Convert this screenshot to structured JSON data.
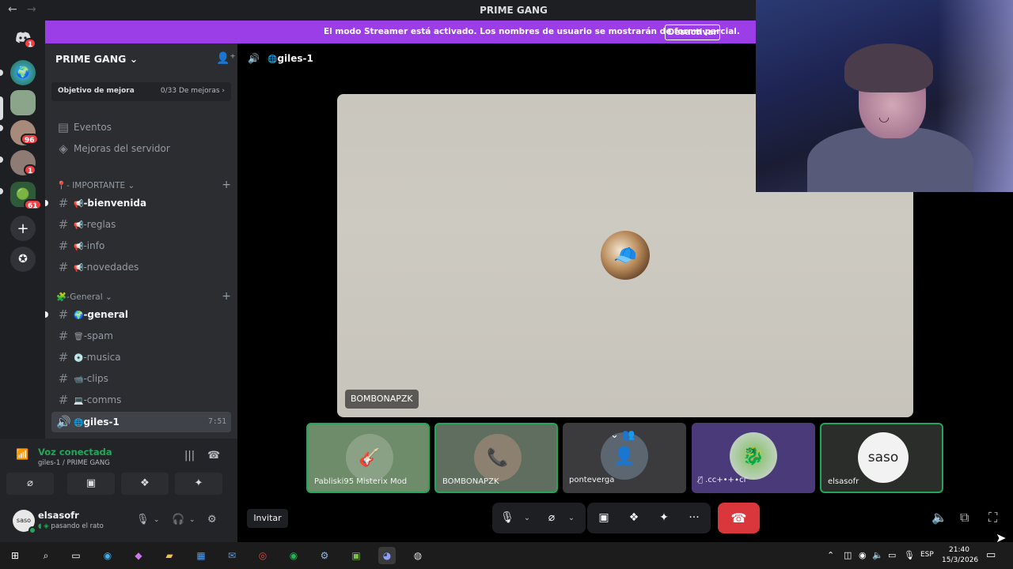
{
  "window": {
    "title": "PRIME GANG"
  },
  "banner": {
    "text": "El modo Streamer está activado. Los nombres de usuario se mostrarán de forma parcial.",
    "button": "Desactivar"
  },
  "servers": [
    {
      "icon": "discord-home-icon",
      "badge": "1"
    },
    {
      "icon": "globe-server-icon",
      "badge": ""
    },
    {
      "icon": "server-avatar-icon",
      "badge": ""
    },
    {
      "icon": "server-avatar-icon",
      "badge": "96"
    },
    {
      "icon": "server-avatar-icon",
      "badge": "1"
    },
    {
      "icon": "server-folder-icon",
      "badge": "61"
    }
  ],
  "sidebar": {
    "server_name": "PRIME GANG",
    "boost": {
      "label": "Objetivo de mejora",
      "progress": "0/33 De mejoras"
    },
    "menu": [
      {
        "label": "Eventos"
      },
      {
        "label": "Mejoras del servidor"
      }
    ],
    "categories": [
      {
        "label": "- IMPORTANTE",
        "channels": [
          {
            "name": "-bienvenida",
            "unread": true
          },
          {
            "name": "-reglas",
            "unread": false
          },
          {
            "name": "-info",
            "unread": false
          },
          {
            "name": "-novedades",
            "unread": false
          }
        ]
      },
      {
        "label": "-General",
        "channels": [
          {
            "name": "-general",
            "unread": true
          },
          {
            "name": "-spam",
            "unread": false
          },
          {
            "name": "-musica",
            "unread": false
          },
          {
            "name": "-clips",
            "unread": false
          },
          {
            "name": "-comms",
            "unread": false
          }
        ]
      }
    ],
    "voice_channel": {
      "name": "giles-1",
      "time": "7:51"
    }
  },
  "voice_panel": {
    "title": "Voz conectada",
    "subtitle": "giles-1 / PRIME GANG"
  },
  "user": {
    "avatar_text": "saso",
    "name": "elsasofr",
    "status": "pasando el rato"
  },
  "call": {
    "channel": "giles-1",
    "main_speaker": "BOMBONAPZK",
    "invite": "Invitar",
    "tiles": [
      {
        "name": "Pabliski95 Misterix Mod",
        "speaking": true,
        "bg": "#6e8b6a",
        "muted": false,
        "icon": ""
      },
      {
        "name": "BOMBONAPZK",
        "speaking": true,
        "bg": "#5f6e5e",
        "muted": false,
        "icon": "phone-icon"
      },
      {
        "name": "pontevergа",
        "speaking": false,
        "bg": "#3b3b3e",
        "muted": false,
        "icon": ""
      },
      {
        "name": ".сс+•+∙сг",
        "speaking": false,
        "bg": "#4b3a7a",
        "muted": true,
        "icon": ""
      },
      {
        "name": "elsasofr",
        "speaking": true,
        "bg": "#2a2d2a",
        "muted": false,
        "icon": ""
      }
    ],
    "saso_text": "saso"
  },
  "taskbar": {
    "language": "ESP",
    "time": "21:40",
    "date": "15/3/2026"
  },
  "colors": {
    "accent_green": "#23a55a",
    "banner_purple": "#9b3ee8",
    "hangup_red": "#da373c",
    "badge_red": "#f23f43"
  }
}
